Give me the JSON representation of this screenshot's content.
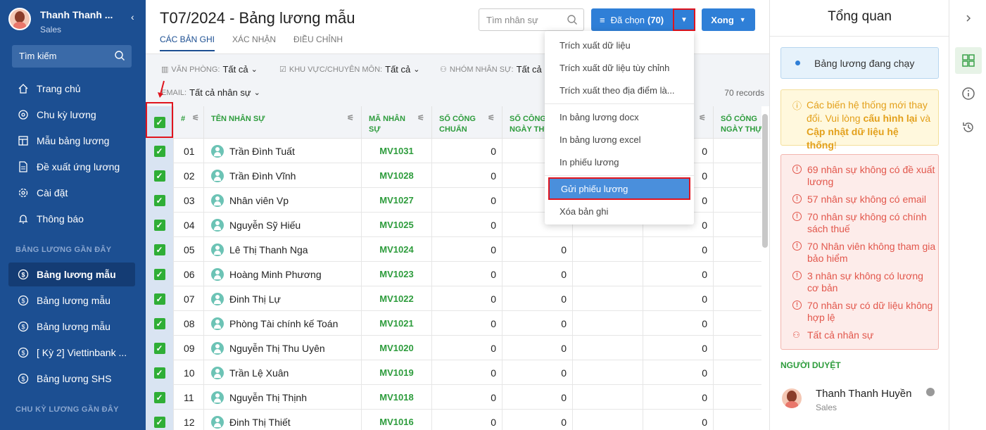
{
  "sidebar": {
    "user_name": "Thanh Thanh ...",
    "user_role": "Sales",
    "search_label": "Tìm kiếm",
    "nav": [
      "Trang chủ",
      "Chu kỳ lương",
      "Mẫu bảng lương",
      "Đề xuất ứng lương",
      "Cài đặt",
      "Thông báo"
    ],
    "recent_title": "BẢNG LƯƠNG GẦN ĐÂY",
    "recent": [
      "Bảng lương mẫu",
      "Bảng lương mẫu",
      "Bảng lương mẫu",
      "[ Kỳ 2] Viettinbank ...",
      "Bảng lương SHS"
    ],
    "cycle_title": "CHU KỲ LƯƠNG GẦN ĐÂY"
  },
  "header": {
    "title": "T07/2024 - Bảng lương mẫu",
    "tabs": [
      "CÁC BẢN GHI",
      "XÁC NHẬN",
      "ĐIỀU CHỈNH"
    ],
    "search_placeholder": "Tìm nhân sự",
    "selected_label": "Đã chọn",
    "selected_count": "(70)",
    "done_label": "Xong"
  },
  "filters": {
    "office_label": "VĂN PHÒNG:",
    "office_value": "Tất cả",
    "area_label": "KHU VỰC/CHUYÊN MÔN:",
    "area_value": "Tất cả",
    "group_label": "NHÓM NHÂN SỰ:",
    "group_value": "Tất cả",
    "email_label": "EMAIL:",
    "email_value": "Tất cả nhân sự",
    "records": "70 records"
  },
  "table": {
    "headers": [
      "#",
      "TÊN NHÂN SỰ",
      "MÃ NHÂN SỰ",
      "SỐ CÔNG CHUẨN",
      "SỐ CÔNG NGÀY THỰ",
      "SỐ CÔNG NGÀY THỰC"
    ],
    "rows": [
      {
        "no": "01",
        "name": "Trần Đình Tuất",
        "code": "MV1031",
        "c1": "0",
        "c4": "0"
      },
      {
        "no": "02",
        "name": "Trần Đình Vĩnh",
        "code": "MV1028",
        "c1": "0",
        "c4": "0"
      },
      {
        "no": "03",
        "name": "Nhân viên Vp",
        "code": "MV1027",
        "c1": "0",
        "c4": "0"
      },
      {
        "no": "04",
        "name": "Nguyễn Sỹ Hiếu",
        "code": "MV1025",
        "c1": "0",
        "c4": "0"
      },
      {
        "no": "05",
        "name": "Lê Thị Thanh Nga",
        "code": "MV1024",
        "c1": "0",
        "c2": "0",
        "c4": "0"
      },
      {
        "no": "06",
        "name": "Hoàng Minh Phương",
        "code": "MV1023",
        "c1": "0",
        "c2": "0",
        "c4": "0"
      },
      {
        "no": "07",
        "name": "Đinh Thị Lự",
        "code": "MV1022",
        "c1": "0",
        "c2": "0",
        "c4": "0"
      },
      {
        "no": "08",
        "name": "Phòng Tài chính kế Toán",
        "code": "MV1021",
        "c1": "0",
        "c2": "0",
        "c4": "0"
      },
      {
        "no": "09",
        "name": "Nguyễn Thị Thu Uyên",
        "code": "MV1020",
        "c1": "0",
        "c2": "0",
        "c4": "0"
      },
      {
        "no": "10",
        "name": "Trần Lệ Xuân",
        "code": "MV1019",
        "c1": "0",
        "c2": "0",
        "c4": "0"
      },
      {
        "no": "11",
        "name": "Nguyễn Thị Thịnh",
        "code": "MV1018",
        "c1": "0",
        "c2": "0",
        "c4": "0"
      },
      {
        "no": "12",
        "name": "Đinh Thị Thiết",
        "code": "MV1016",
        "c1": "0",
        "c2": "0",
        "c4": "0"
      }
    ]
  },
  "menu": {
    "items": [
      "Trích xuất dữ liệu",
      "Trích xuất dữ liệu tùy chỉnh",
      "Trích xuất theo địa điểm là...",
      "In bảng lương docx",
      "In bảng lương excel",
      "In phiếu lương",
      "Gửi phiếu lương",
      "Xóa bản ghi"
    ]
  },
  "overview": {
    "title": "Tổng quan",
    "running": "Bảng lương đang chạy",
    "warn_pre": "Các biến hệ thống mới thay đổi. Vui lòng ",
    "warn_link1": "cấu hình lại",
    "warn_mid": " và ",
    "warn_link2": "Cập nhật dữ liệu hệ thống",
    "warn_post": "!",
    "errors": [
      "69 nhân sự không có đề xuất lương",
      "57 nhân sự không có email",
      "70 nhân sự không có chính sách thuế",
      "70 Nhân viên không tham gia bảo hiểm",
      "3 nhân sự không có lương cơ bản",
      "70 nhân sự có dữ liệu không hợp lệ"
    ],
    "all_staff": "Tất cả nhân sự",
    "approver_title": "NGƯỜI DUYỆT",
    "approver_name": "Thanh Thanh Huyền",
    "approver_role": "Sales"
  }
}
